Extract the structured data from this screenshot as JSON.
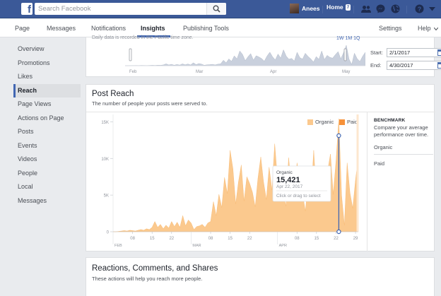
{
  "topbar": {
    "search_placeholder": "Search Facebook",
    "user_name": "Anees",
    "home_label": "Home",
    "home_count": "7",
    "brand_color": "#3b5998"
  },
  "page_nav": {
    "items": [
      "Page",
      "Messages",
      "Notifications",
      "Insights",
      "Publishing Tools"
    ],
    "active": "Insights",
    "settings_label": "Settings",
    "help_label": "Help"
  },
  "sidebar": {
    "items": [
      {
        "label": "Overview"
      },
      {
        "label": "Promotions"
      },
      {
        "label": "Likes"
      },
      {
        "label": "Reach",
        "active": true
      },
      {
        "label": "Page Views"
      },
      {
        "label": "Actions on Page"
      },
      {
        "label": "Posts"
      },
      {
        "label": "Events"
      },
      {
        "label": "Videos"
      },
      {
        "label": "People"
      },
      {
        "label": "Local"
      },
      {
        "label": "Messages"
      }
    ]
  },
  "date_range": {
    "note": "Daily data is recorded in the Pacific time zone.",
    "quick_links": "1W 1M 1Q",
    "start_label": "Start:",
    "start_value": "2/1/2017",
    "end_label": "End:",
    "end_value": "4/30/2017",
    "overview_months": [
      "Feb",
      "Mar",
      "Apr",
      "May"
    ]
  },
  "post_reach": {
    "title": "Post Reach",
    "subtitle": "The number of people your posts were served to.",
    "legend": {
      "organic": "Organic",
      "paid": "Paid"
    },
    "colors": {
      "organic": "#fbc98e",
      "paid": "#f7923a",
      "cursor": "#4267b2"
    },
    "tooltip": {
      "series": "Organic",
      "value": "15,421",
      "date": "Apr 22, 2017",
      "hint": "Click or drag to select"
    },
    "benchmark": {
      "title": "BENCHMARK",
      "description": "Compare your average performance over time.",
      "rows": [
        "Organic",
        "Paid"
      ]
    }
  },
  "reactions": {
    "title": "Reactions, Comments, and Shares",
    "subtitle": "These actions will help you reach more people."
  },
  "chart_data": {
    "type": "area",
    "title": "Post Reach",
    "y_ticks": [
      "0",
      "5K",
      "10K",
      "15K"
    ],
    "ylim": [
      0,
      16000
    ],
    "x_ticks": [
      "08",
      "15",
      "22",
      "08",
      "15",
      "22",
      "08",
      "15",
      "22",
      "29"
    ],
    "month_labels": [
      "FEB",
      "MAR",
      "APR"
    ],
    "grid": false,
    "legend_position": "top-right",
    "series": [
      {
        "name": "Organic",
        "values": [
          0,
          0,
          50,
          100,
          150,
          100,
          200,
          150,
          100,
          200,
          300,
          200,
          400,
          300,
          600,
          1400,
          600,
          1000,
          400,
          900,
          500,
          1400,
          700,
          1300,
          600,
          2200,
          800,
          1600,
          1200,
          300,
          700,
          800,
          1000,
          600,
          1200,
          1400,
          4100,
          2200,
          5100,
          3300,
          7400,
          5200,
          11100,
          8600,
          3800,
          6800,
          9100,
          4200,
          7500,
          6600,
          5400,
          3400,
          7300,
          10200,
          6800,
          4400,
          8800,
          5700,
          12000,
          7200,
          4900,
          5500,
          3500,
          10100,
          6100,
          5000,
          9400,
          7000,
          5200,
          2800,
          6900,
          4800,
          11100,
          4600,
          7800,
          6300,
          5700,
          8300,
          10600,
          5100,
          9700,
          15421,
          5000,
          900,
          9400,
          5300,
          3200,
          7100,
          10200
        ]
      },
      {
        "name": "Paid",
        "values": [
          0,
          0,
          0,
          0,
          0,
          0,
          0,
          0,
          0,
          0,
          0,
          0,
          0,
          0,
          0,
          0,
          0,
          0,
          0,
          0,
          0,
          0,
          0,
          0,
          0,
          0,
          0,
          0,
          0,
          0,
          0,
          0,
          0,
          0,
          0,
          0,
          0,
          0,
          0,
          0,
          0,
          0,
          0,
          0,
          0,
          0,
          0,
          0,
          0,
          0,
          0,
          0,
          0,
          0,
          0,
          0,
          0,
          0,
          0,
          0,
          0,
          0,
          0,
          0,
          0,
          0,
          0,
          0,
          0,
          0,
          0,
          0,
          0,
          0,
          0,
          0,
          0,
          0,
          0,
          0,
          0,
          0,
          0,
          0,
          0,
          0,
          0,
          0,
          0
        ]
      }
    ],
    "cursor_index": 81
  }
}
